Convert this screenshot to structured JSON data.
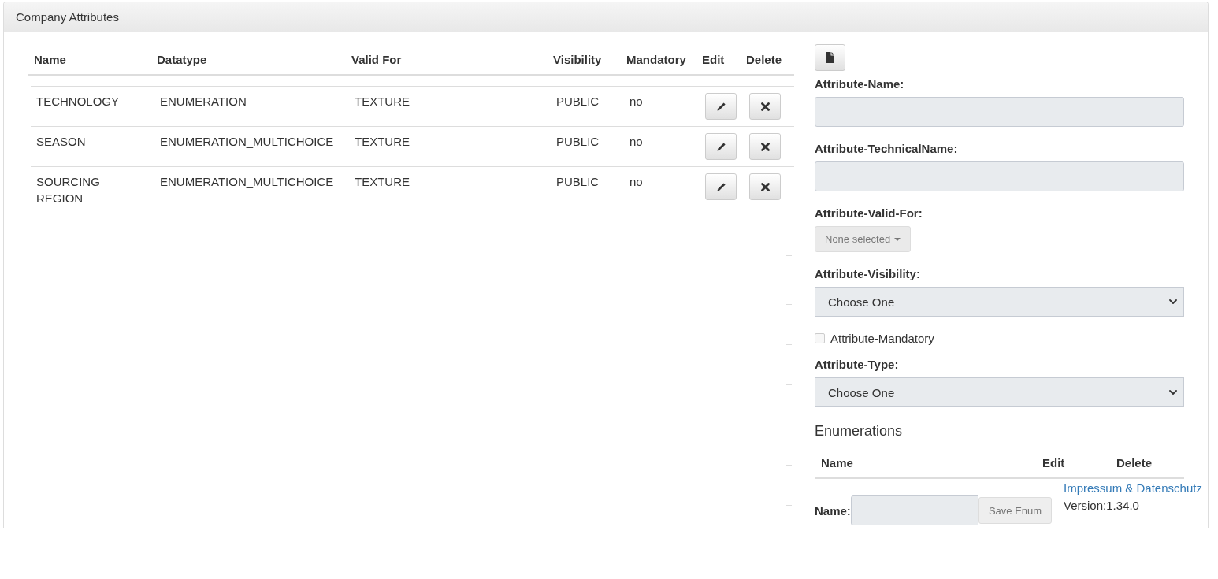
{
  "panel": {
    "title": "Company Attributes"
  },
  "attributes_table": {
    "columns": [
      "Name",
      "Datatype",
      "Valid For",
      "Visibility",
      "Mandatory",
      "Edit",
      "Delete"
    ],
    "rows": [
      {
        "name": "TECHNOLOGY",
        "datatype": "ENUMERATION",
        "valid_for": "TEXTURE",
        "visibility": "PUBLIC",
        "mandatory": "no"
      },
      {
        "name": "SEASON",
        "datatype": "ENUMERATION_MULTICHOICE",
        "valid_for": "TEXTURE",
        "visibility": "PUBLIC",
        "mandatory": "no"
      },
      {
        "name": "SOURCING REGION",
        "datatype": "ENUMERATION_MULTICHOICE",
        "valid_for": "TEXTURE",
        "visibility": "PUBLIC",
        "mandatory": "no"
      }
    ]
  },
  "form": {
    "fields": [
      {
        "kind": "text",
        "label": "Attribute-Name:"
      },
      {
        "kind": "text",
        "label": "Attribute-TechnicalName:"
      },
      {
        "kind": "multiselect",
        "label": "Attribute-Valid-For:",
        "value": "None selected",
        "disabled": true
      },
      {
        "kind": "select",
        "label": "Attribute-Visibility:",
        "value": "Choose One"
      },
      {
        "kind": "checkbox",
        "label": "Attribute-Mandatory",
        "checked": false
      },
      {
        "kind": "select",
        "label": "Attribute-Type:",
        "value": "Choose One"
      }
    ]
  },
  "enumerations": {
    "title": "Enumerations",
    "columns": [
      "Name",
      "Edit",
      "Delete"
    ],
    "name_label": "Name:",
    "save_button": {
      "label": "Save Enum",
      "disabled": true
    }
  },
  "footer": {
    "link": "Impressum & Datenschutz",
    "version": "Version:1.34.0"
  }
}
